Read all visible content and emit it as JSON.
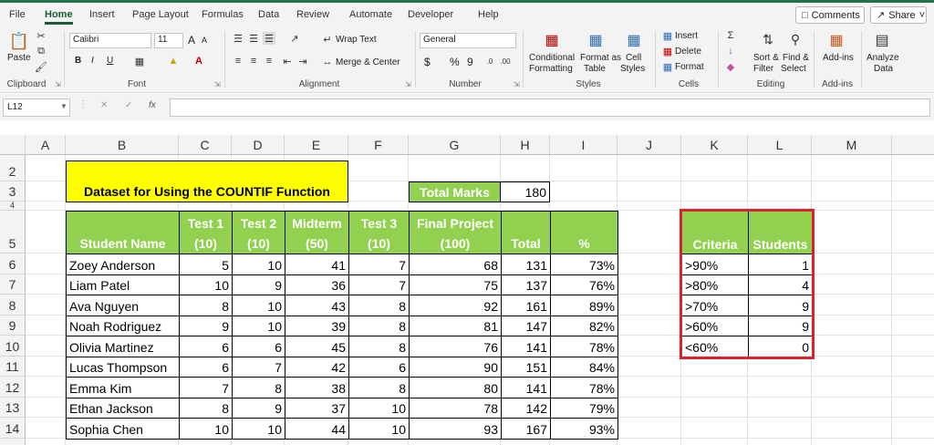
{
  "tabs": [
    "File",
    "Home",
    "Insert",
    "Page Layout",
    "Formulas",
    "Data",
    "Review",
    "Automate",
    "Developer",
    "Help"
  ],
  "active_tab": "Home",
  "top_buttons": {
    "comments": "Comments",
    "share": "Share"
  },
  "ribbon": {
    "clipboard": {
      "paste": "Paste",
      "label": "Clipboard"
    },
    "font": {
      "name": "Calibri",
      "size": "11",
      "label": "Font",
      "bold": "B",
      "italic": "I",
      "underline": "U",
      "grow": "A",
      "shrink": "A"
    },
    "alignment": {
      "wrap_text": "Wrap Text",
      "merge_center": "Merge & Center",
      "label": "Alignment"
    },
    "number": {
      "format": "General",
      "currency": "$",
      "percent": "%",
      "comma": "9",
      "label": "Number"
    },
    "styles": {
      "conditional": "Conditional",
      "formatting": "Formatting",
      "format_as": "Format as",
      "table": "Table",
      "cell": "Cell",
      "styles": "Styles",
      "label": "Styles"
    },
    "cells": {
      "insert": "Insert",
      "delete": "Delete",
      "format": "Format",
      "label": "Cells"
    },
    "editing": {
      "sort": "Sort &",
      "filter": "Filter",
      "find": "Find &",
      "select": "Select",
      "label": "Editing"
    },
    "addins": {
      "addins": "Add-ins",
      "label": "Add-ins"
    },
    "analyze": {
      "line1": "Analyze",
      "line2": "Data"
    }
  },
  "formula_bar": {
    "name_box": "L12",
    "fx": "fx",
    "value": ""
  },
  "columns": [
    "A",
    "B",
    "C",
    "D",
    "E",
    "F",
    "G",
    "H",
    "I",
    "J",
    "K",
    "L",
    "M"
  ],
  "rows": [
    "2",
    "3",
    "4",
    "5",
    "6",
    "7",
    "8",
    "9",
    "10",
    "11",
    "12",
    "13",
    "14"
  ],
  "sheet": {
    "title": "Dataset for Using the COUNTIF Function",
    "total_marks_label": "Total Marks",
    "total_marks_value": "180",
    "headers": [
      {
        "l1": "",
        "l2": "Student Name"
      },
      {
        "l1": "Test 1",
        "l2": "(10)"
      },
      {
        "l1": "Test 2",
        "l2": "(10)"
      },
      {
        "l1": "Midterm",
        "l2": "(50)"
      },
      {
        "l1": "Test 3",
        "l2": "(10)"
      },
      {
        "l1": "Final Project",
        "l2": "(100)"
      },
      {
        "l1": "",
        "l2": "Total"
      },
      {
        "l1": "",
        "l2": "%"
      }
    ],
    "students": [
      {
        "name": "Zoey Anderson",
        "t1": "5",
        "t2": "10",
        "mid": "41",
        "t3": "7",
        "fp": "68",
        "total": "131",
        "pct": "73%"
      },
      {
        "name": "Liam Patel",
        "t1": "10",
        "t2": "9",
        "mid": "36",
        "t3": "7",
        "fp": "75",
        "total": "137",
        "pct": "76%"
      },
      {
        "name": "Ava Nguyen",
        "t1": "8",
        "t2": "10",
        "mid": "43",
        "t3": "8",
        "fp": "92",
        "total": "161",
        "pct": "89%"
      },
      {
        "name": "Noah Rodriguez",
        "t1": "9",
        "t2": "10",
        "mid": "39",
        "t3": "8",
        "fp": "81",
        "total": "147",
        "pct": "82%"
      },
      {
        "name": "Olivia Martinez",
        "t1": "6",
        "t2": "6",
        "mid": "45",
        "t3": "8",
        "fp": "76",
        "total": "141",
        "pct": "78%"
      },
      {
        "name": "Lucas Thompson",
        "t1": "6",
        "t2": "7",
        "mid": "42",
        "t3": "6",
        "fp": "90",
        "total": "151",
        "pct": "84%"
      },
      {
        "name": "Emma Kim",
        "t1": "7",
        "t2": "8",
        "mid": "38",
        "t3": "8",
        "fp": "80",
        "total": "141",
        "pct": "78%"
      },
      {
        "name": "Ethan Jackson",
        "t1": "8",
        "t2": "9",
        "mid": "37",
        "t3": "10",
        "fp": "78",
        "total": "142",
        "pct": "79%"
      },
      {
        "name": "Sophia Chen",
        "t1": "10",
        "t2": "10",
        "mid": "44",
        "t3": "10",
        "fp": "93",
        "total": "167",
        "pct": "93%"
      }
    ],
    "criteria_header": "Criteria",
    "students_header": "Students",
    "criteria": [
      {
        "c": ">90%",
        "n": "1"
      },
      {
        "c": ">80%",
        "n": "4"
      },
      {
        "c": ">70%",
        "n": "9"
      },
      {
        "c": ">60%",
        "n": "9"
      },
      {
        "c": "<60%",
        "n": "0"
      }
    ]
  },
  "colors": {
    "header_green": "#92d050",
    "title_yellow": "#ffff00",
    "highlight_red": "#e0202a",
    "excel_green": "#217346"
  }
}
